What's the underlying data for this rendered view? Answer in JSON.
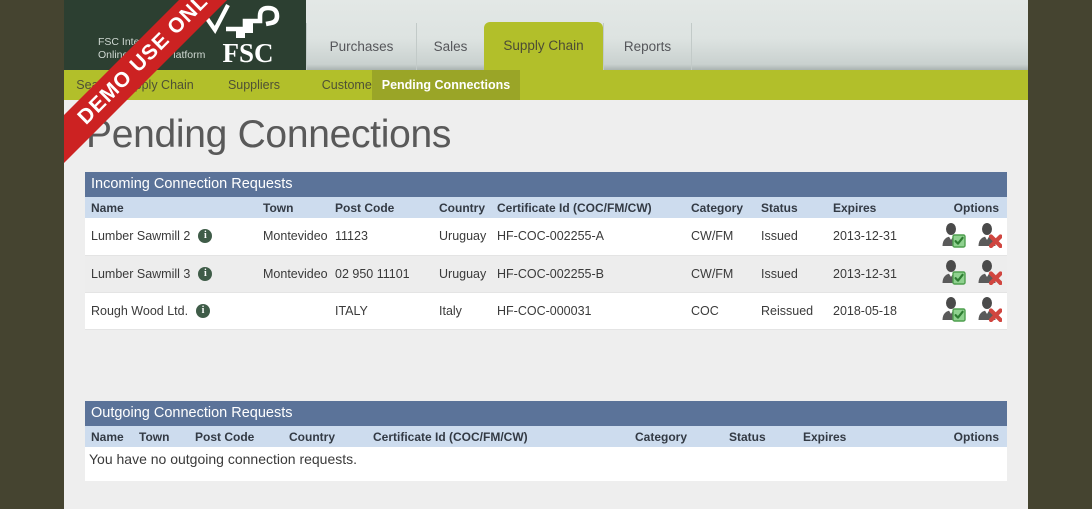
{
  "ribbon": {
    "text": "DEMO USE ONLY"
  },
  "brand": {
    "line1": "FSC International",
    "line2": "Online Claims Platform",
    "logo_text": "FSC",
    "logo_icon": "fsc-checkmark-tree-logo"
  },
  "primary_nav": {
    "items": [
      {
        "label": "Purchases",
        "active": false
      },
      {
        "label": "Sales",
        "active": false
      },
      {
        "label": "Supply Chain",
        "active": true
      },
      {
        "label": "Reports",
        "active": false
      }
    ]
  },
  "secondary_nav": {
    "items": [
      {
        "label": "Search Supply Chain",
        "active": false
      },
      {
        "label": "Suppliers",
        "active": false
      },
      {
        "label": "Customers",
        "active": false
      },
      {
        "label": "Pending Connections",
        "active": true
      }
    ]
  },
  "page": {
    "title": "Pending Connections"
  },
  "columns": [
    "Name",
    "Town",
    "Post Code",
    "Country",
    "Certificate Id (COC/FM/CW)",
    "Category",
    "Status",
    "Expires",
    "Options"
  ],
  "incoming": {
    "heading": "Incoming Connection Requests",
    "rows": [
      {
        "name": "Lumber Sawmill 2",
        "town": "Montevideo",
        "post_code": "11123",
        "country": "Uruguay",
        "certificate_id": "HF-COC-002255-A",
        "category": "CW/FM",
        "status": "Issued",
        "expires": "2013-12-31",
        "info_icon": "info-icon",
        "accept_icon": "user-accept-icon",
        "reject_icon": "user-reject-icon"
      },
      {
        "name": "Lumber Sawmill 3",
        "town": "Montevideo",
        "post_code": "02 950 11101",
        "country": "Uruguay",
        "certificate_id": "HF-COC-002255-B",
        "category": "CW/FM",
        "status": "Issued",
        "expires": "2013-12-31",
        "info_icon": "info-icon",
        "accept_icon": "user-accept-icon",
        "reject_icon": "user-reject-icon"
      },
      {
        "name": "Rough Wood Ltd.",
        "town": "",
        "post_code": "ITALY",
        "country": "Italy",
        "certificate_id": "HF-COC-000031",
        "category": "COC",
        "status": "Reissued",
        "expires": "2018-05-18",
        "info_icon": "info-icon",
        "accept_icon": "user-accept-icon",
        "reject_icon": "user-reject-icon"
      }
    ]
  },
  "outgoing": {
    "heading": "Outgoing Connection Requests",
    "empty_message": "You have no outgoing connection requests.",
    "rows": []
  },
  "colors": {
    "brand_green": "#2c3f31",
    "nav_green": "#b2bf2a",
    "nav_green_active": "#9aa527",
    "panel_blue": "#5b7399",
    "col_header_blue": "#cddcee",
    "page_outer": "#454430",
    "ribbon_red": "#cc2222",
    "accept_green": "#5cb85c",
    "reject_red": "#d9534f"
  }
}
